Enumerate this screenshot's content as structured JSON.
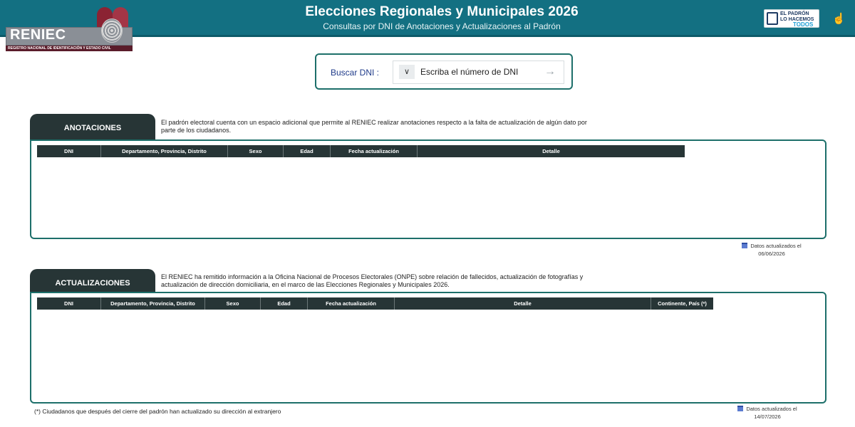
{
  "header": {
    "title": "Elecciones Regionales y Municipales 2026",
    "subtitle": "Consultas por DNI de Anotaciones y Actualizaciones al Padrón",
    "colors": {
      "bar": "#137082",
      "accent_dark": "#273536",
      "border": "#1d6f6a"
    }
  },
  "logo": {
    "name": "RENIEC",
    "tagline": "REGISTRO NACIONAL DE IDENTIFICACIÓN Y ESTADO CIVIL"
  },
  "badge": {
    "line1": "EL PADRÓN",
    "line2": "LO HACEMOS",
    "line3": "TODOS"
  },
  "search": {
    "label": "Buscar DNI :",
    "placeholder": "Escriba el número de DNI",
    "icons": {
      "dropdown": "chevron-down-icon",
      "submit": "arrow-right-icon"
    }
  },
  "anotaciones": {
    "tab_label": "ANOTACIONES",
    "description": "El padrón electoral cuenta con un espacio adicional que permite al RENIEC realizar anotaciones respecto a la falta de actualización de algún dato por parte de los ciudadanos.",
    "columns": [
      "DNI",
      "Departamento, Provincia, Distrito",
      "Sexo",
      "Edad",
      "Fecha actualización",
      "Detalle"
    ],
    "rows": [],
    "updated_label": "Datos actualizados el",
    "updated_date": "06/06/2026"
  },
  "actualizaciones": {
    "tab_label": "ACTUALIZACIONES",
    "description": "El RENIEC ha remitido información a la Oficina Nacional de Procesos Electorales (ONPE) sobre relación de fallecidos, actualización de fotografías y actualización de dirección domiciliaria, en el marco de las Elecciones Regionales y Municipales 2026.",
    "columns": [
      "DNI",
      "Departamento, Provincia, Distrito",
      "Sexo",
      "Edad",
      "Fecha actualización",
      "Detalle",
      "Continente, País (*)"
    ],
    "rows": [],
    "updated_label": "Datos actualizados el",
    "updated_date": "14/07/2026"
  },
  "footnote": "(*) Ciudadanos que después del cierre del padrón han actualizado su dirección al extranjero"
}
